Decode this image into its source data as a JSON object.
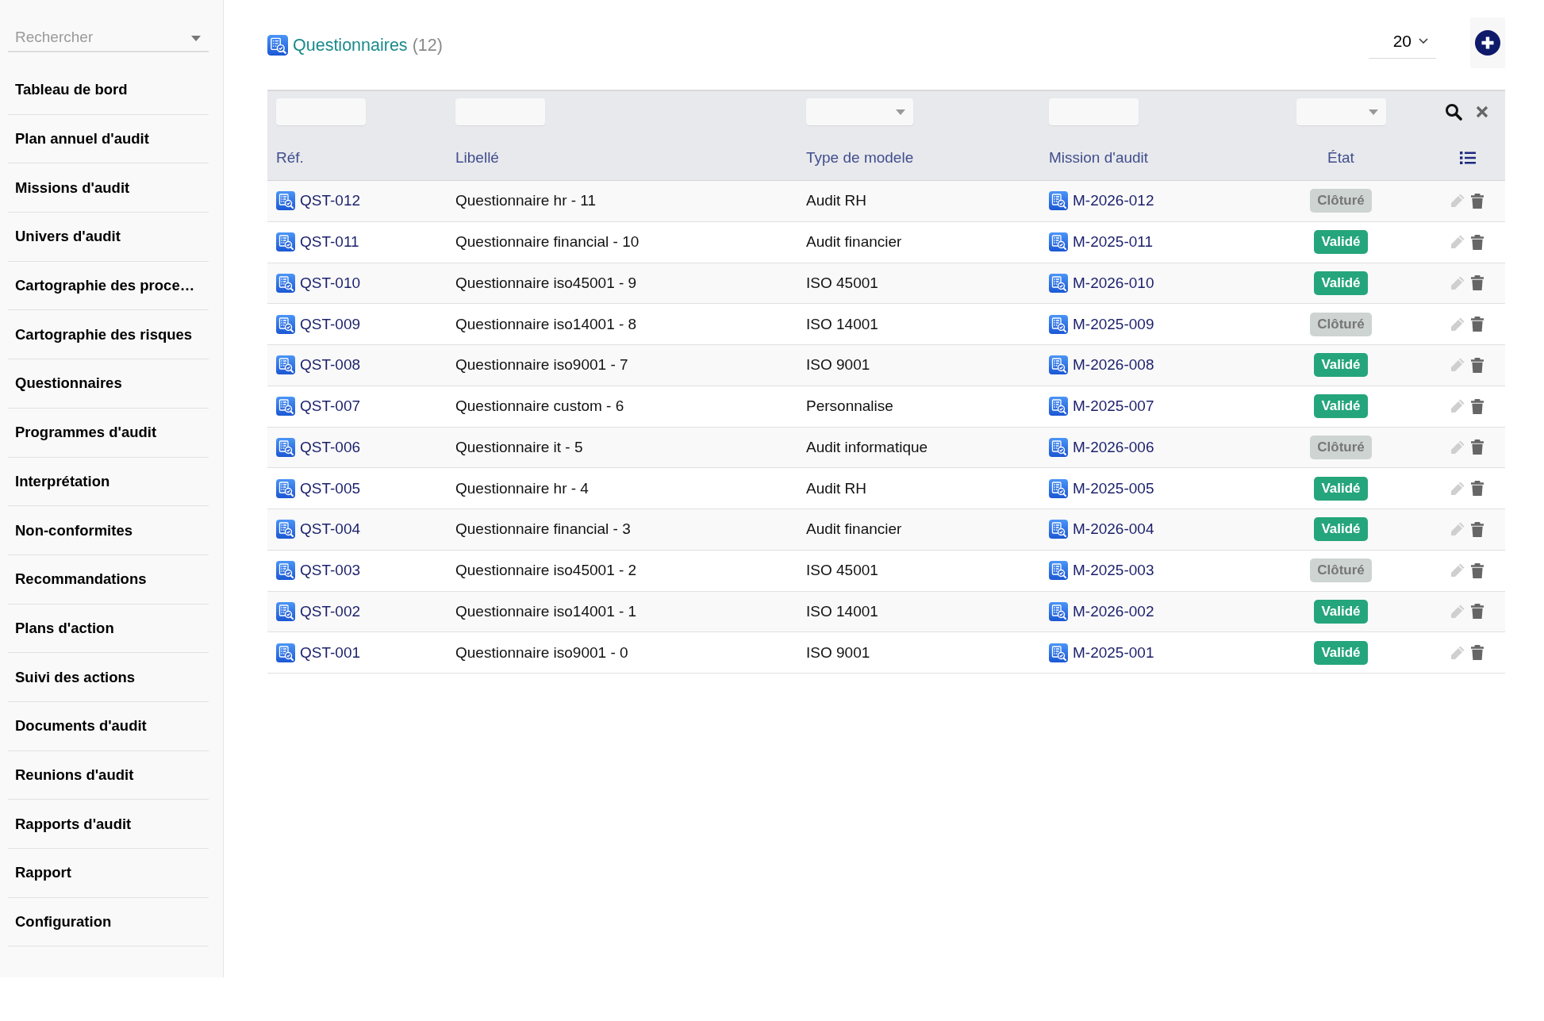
{
  "sidebar": {
    "search": {
      "placeholder": "Rechercher"
    },
    "items": [
      {
        "label": "Tableau de bord"
      },
      {
        "label": "Plan annuel d'audit"
      },
      {
        "label": "Missions d'audit"
      },
      {
        "label": "Univers d'audit"
      },
      {
        "label": "Cartographie des proce…"
      },
      {
        "label": "Cartographie des risques"
      },
      {
        "label": "Questionnaires"
      },
      {
        "label": "Programmes d'audit"
      },
      {
        "label": "Interprétation"
      },
      {
        "label": "Non-conformites"
      },
      {
        "label": "Recommandations"
      },
      {
        "label": "Plans d'action"
      },
      {
        "label": "Suivi des actions"
      },
      {
        "label": "Documents d'audit"
      },
      {
        "label": "Reunions d'audit"
      },
      {
        "label": "Rapports d'audit"
      },
      {
        "label": "Rapport"
      },
      {
        "label": "Configuration"
      }
    ]
  },
  "header": {
    "title": "Questionnaires",
    "count": "(12)",
    "page_size": "20"
  },
  "table": {
    "columns": [
      {
        "label": "Réf.",
        "kind": "text"
      },
      {
        "label": "Libellé",
        "kind": "text"
      },
      {
        "label": "Type de modele",
        "kind": "select"
      },
      {
        "label": "Mission d'audit",
        "kind": "text"
      },
      {
        "label": "État",
        "kind": "select"
      }
    ],
    "rows": [
      {
        "ref": "QST-012",
        "label": "Questionnaire hr - 11",
        "type": "Audit RH",
        "mission": "M-2026-012",
        "status": {
          "text": "Clôturé",
          "kind": "closed"
        }
      },
      {
        "ref": "QST-011",
        "label": "Questionnaire financial - 10",
        "type": "Audit financier",
        "mission": "M-2025-011",
        "status": {
          "text": "Validé",
          "kind": "validated"
        }
      },
      {
        "ref": "QST-010",
        "label": "Questionnaire iso45001 - 9",
        "type": "ISO 45001",
        "mission": "M-2026-010",
        "status": {
          "text": "Validé",
          "kind": "validated"
        }
      },
      {
        "ref": "QST-009",
        "label": "Questionnaire iso14001 - 8",
        "type": "ISO 14001",
        "mission": "M-2025-009",
        "status": {
          "text": "Clôturé",
          "kind": "closed"
        }
      },
      {
        "ref": "QST-008",
        "label": "Questionnaire iso9001 - 7",
        "type": "ISO 9001",
        "mission": "M-2026-008",
        "status": {
          "text": "Validé",
          "kind": "validated"
        }
      },
      {
        "ref": "QST-007",
        "label": "Questionnaire custom - 6",
        "type": "Personnalise",
        "mission": "M-2025-007",
        "status": {
          "text": "Validé",
          "kind": "validated"
        }
      },
      {
        "ref": "QST-006",
        "label": "Questionnaire it - 5",
        "type": "Audit informatique",
        "mission": "M-2026-006",
        "status": {
          "text": "Clôturé",
          "kind": "closed"
        }
      },
      {
        "ref": "QST-005",
        "label": "Questionnaire hr - 4",
        "type": "Audit RH",
        "mission": "M-2025-005",
        "status": {
          "text": "Validé",
          "kind": "validated"
        }
      },
      {
        "ref": "QST-004",
        "label": "Questionnaire financial - 3",
        "type": "Audit financier",
        "mission": "M-2026-004",
        "status": {
          "text": "Validé",
          "kind": "validated"
        }
      },
      {
        "ref": "QST-003",
        "label": "Questionnaire iso45001 - 2",
        "type": "ISO 45001",
        "mission": "M-2025-003",
        "status": {
          "text": "Clôturé",
          "kind": "closed"
        }
      },
      {
        "ref": "QST-002",
        "label": "Questionnaire iso14001 - 1",
        "type": "ISO 14001",
        "mission": "M-2026-002",
        "status": {
          "text": "Validé",
          "kind": "validated"
        }
      },
      {
        "ref": "QST-001",
        "label": "Questionnaire iso9001 - 0",
        "type": "ISO 9001",
        "mission": "M-2025-001",
        "status": {
          "text": "Validé",
          "kind": "validated"
        }
      }
    ]
  }
}
